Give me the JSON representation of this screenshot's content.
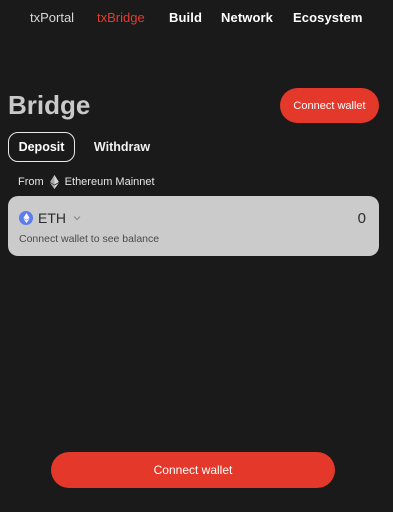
{
  "nav": {
    "items": [
      {
        "label": "txPortal"
      },
      {
        "label": "txBridge"
      },
      {
        "label": "Build"
      },
      {
        "label": "Network"
      },
      {
        "label": "Ecosystem"
      }
    ],
    "active_color": "#e8392a"
  },
  "page": {
    "title": "Bridge",
    "connect_label": "Connect wallet"
  },
  "tabs": [
    {
      "label": "Deposit",
      "selected": true
    },
    {
      "label": "Withdraw",
      "selected": false
    }
  ],
  "from": {
    "label": "From",
    "network_icon": "ethereum-icon",
    "network": "Ethereum Mainnet"
  },
  "token_card": {
    "token_icon": "eth-icon",
    "token": "ETH",
    "amount": "0",
    "balance_note": "Connect wallet to see balance"
  },
  "footer": {
    "connect_label": "Connect wallet"
  },
  "colors": {
    "background": "#1a1a1b",
    "accent": "#e4382a",
    "card": "#cbcbcb"
  }
}
